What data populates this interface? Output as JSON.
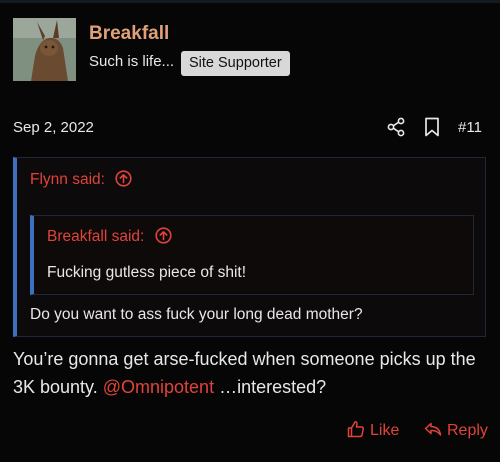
{
  "post": {
    "username": "Breakfall",
    "user_title": "Such is life...",
    "badge": "Site Supporter",
    "date": "Sep 2, 2022",
    "number": "#11",
    "outer_quote": {
      "author_label": "Flynn said:",
      "body": "Do you want to ass fuck your long dead mother?"
    },
    "inner_quote": {
      "author_label": "Breakfall said:",
      "body": "Fucking gutless piece of shit!"
    },
    "message": {
      "part1": "You’re gonna get arse-fucked when someone picks up the 3K bounty.",
      "mention": "@Omnipotent",
      "part2": "…interested?"
    },
    "actions": {
      "like_label": "Like",
      "reply_label": "Reply"
    }
  },
  "icons": {
    "share": "share-icon",
    "bookmark": "bookmark-icon",
    "quote_up": "arrow-up-circle-icon",
    "like": "thumbs-up-icon",
    "reply": "reply-arrow-icon"
  },
  "colors": {
    "background": "#060606",
    "username": "#e0a078",
    "accent": "#e0433a",
    "quote_border": "#3f6fc0",
    "badge_bg": "#d8d8d8"
  }
}
